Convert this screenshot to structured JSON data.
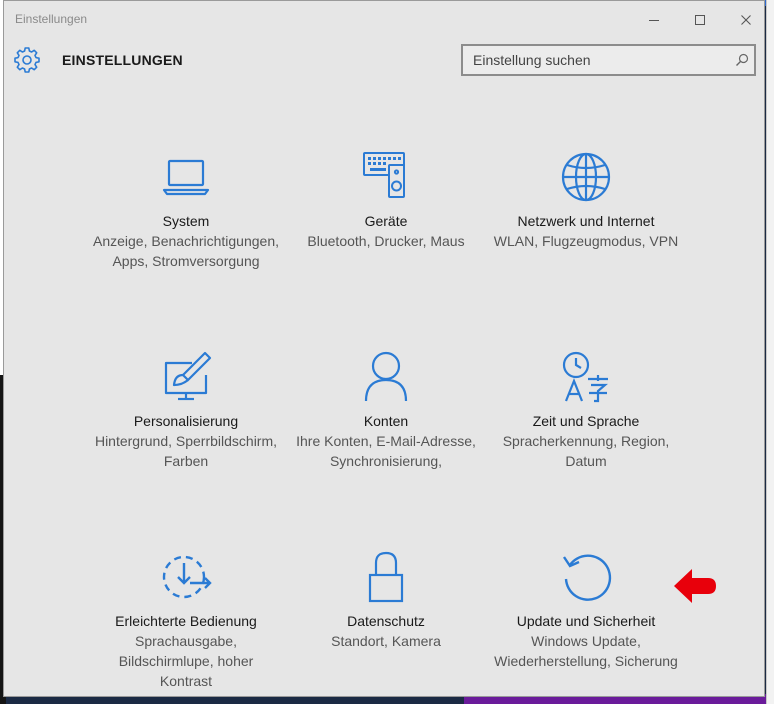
{
  "window": {
    "title": "Einstellungen",
    "minimize_label": "",
    "maximize_label": "",
    "close_label": ""
  },
  "header": {
    "app_title": "EINSTELLUNGEN",
    "search_placeholder": "Einstellung suchen"
  },
  "colors": {
    "accent": "#2b7bd4",
    "arrow": "#e8000b"
  },
  "tiles": [
    {
      "icon": "laptop-icon",
      "title": "System",
      "desc": "Anzeige, Benachrichtigungen, Apps, Stromversorgung"
    },
    {
      "icon": "devices-icon",
      "title": "Geräte",
      "desc": "Bluetooth, Drucker, Maus"
    },
    {
      "icon": "globe-icon",
      "title": "Netzwerk und Internet",
      "desc": "WLAN, Flugzeugmodus, VPN"
    },
    {
      "icon": "personalization-icon",
      "title": "Personalisierung",
      "desc": "Hintergrund, Sperrbildschirm, Farben"
    },
    {
      "icon": "person-icon",
      "title": "Konten",
      "desc": "Ihre Konten, E-Mail-Adresse, Synchronisierung,"
    },
    {
      "icon": "time-language-icon",
      "title": "Zeit und Sprache",
      "desc": "Spracherkennung, Region, Datum"
    },
    {
      "icon": "ease-of-access-icon",
      "title": "Erleichterte Bedienung",
      "desc": "Sprachausgabe, Bildschirmlupe, hoher Kontrast"
    },
    {
      "icon": "lock-icon",
      "title": "Datenschutz",
      "desc": "Standort, Kamera"
    },
    {
      "icon": "update-icon",
      "title": "Update und Sicherheit",
      "desc": "Windows Update, Wiederherstellung, Sicherung"
    }
  ]
}
